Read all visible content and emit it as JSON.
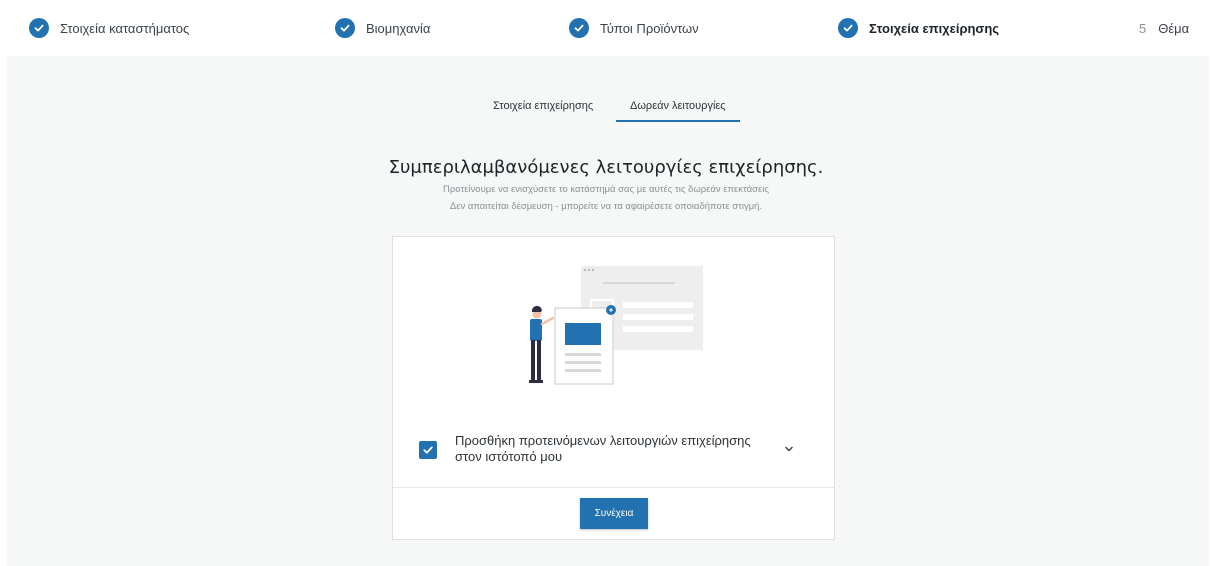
{
  "stepper": {
    "steps": [
      {
        "label": "Στοιχεία καταστήματος",
        "state": "done"
      },
      {
        "label": "Βιομηχανία",
        "state": "done"
      },
      {
        "label": "Τύποι Προϊόντων",
        "state": "done"
      },
      {
        "label": "Στοιχεία επιχείρησης",
        "state": "current"
      },
      {
        "number": "5",
        "label": "Θέμα",
        "state": "pending"
      }
    ]
  },
  "tabs": [
    {
      "label": "Στοιχεία επιχείρησης",
      "active": false
    },
    {
      "label": "Δωρεάν λειτουργίες",
      "active": true
    }
  ],
  "content": {
    "heading": "Συμπεριλαμβανόμενες λειτουργίες επιχείρησης.",
    "subtext_line1": "Προτείνουμε να ενισχύσετε το κατάστημά σας με αυτές τις δωρεάν επεκτάσεις",
    "subtext_line2": "Δεν απαιτείται δέσμευση - μπορείτε να τα αφαιρέσετε οποιαδήποτε στιγμή."
  },
  "card": {
    "option": {
      "label": "Προσθήκη προτεινόμενων λειτουργιών επιχείρησης στον ιστότοπό μου",
      "checked": true
    },
    "continue_label": "Συνέχεια"
  },
  "colors": {
    "accent": "#2271b1",
    "background": "#f6f7f7"
  },
  "icons": [
    "check-circle-icon",
    "checkbox-checked-icon",
    "chevron-down-icon"
  ]
}
